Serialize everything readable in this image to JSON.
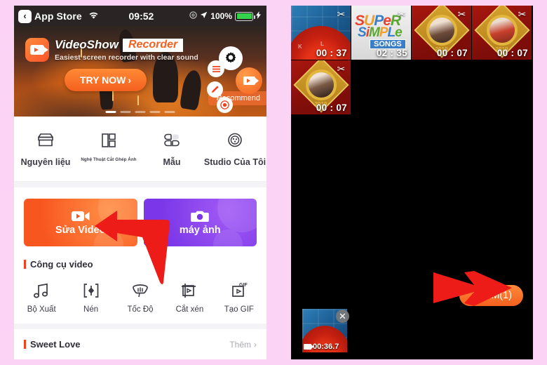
{
  "theme": {
    "page_bg": "#fbd4f5",
    "accent_orange": "#f4601f",
    "accent_purple": "#7a36e8",
    "arrow_red": "#ee1c18"
  },
  "left_phone": {
    "status_bar": {
      "back_label": "App Store",
      "back_icon": "chevron-left-icon",
      "wifi_icon": "wifi-icon",
      "time": "09:52",
      "location_icon": "location-arrow-icon",
      "battery_percent": "100%",
      "charging_icon": "bolt-icon"
    },
    "banner": {
      "app_icon": "videoshow-app-icon",
      "title_main": "VideoShow",
      "title_highlight": "Recorder",
      "subtitle": "Easiest screen recorder with clear sound",
      "cta_label": "TRY NOW",
      "cta_chevron": "›",
      "badge": "Recommend",
      "dots_total": 5,
      "dots_active": 1,
      "float_icons": [
        "gear-icon",
        "list-icon",
        "pen-icon",
        "record-icon",
        "video-camera-icon"
      ]
    },
    "nav_items": [
      {
        "label": "Nguyên liệu",
        "icon": "store-icon",
        "tiny": false
      },
      {
        "label": "Nghệ Thuật Cắt Ghép Ảnh",
        "icon": "collage-icon",
        "tiny": true
      },
      {
        "label": "Mẫu",
        "icon": "template-grid-icon",
        "tiny": false
      },
      {
        "label": "Studio Của Tôi",
        "icon": "studio-circle-icon",
        "tiny": false
      }
    ],
    "action_cards": [
      {
        "label": "Sửa Video",
        "icon": "video-camera-icon",
        "color": "orange"
      },
      {
        "label": "máy ảnh",
        "icon": "photo-camera-icon",
        "color": "purple"
      }
    ],
    "tools_section": {
      "title": "Công cụ video",
      "tools": [
        {
          "label": "Bộ Xuất",
          "icon": "music-note-icon"
        },
        {
          "label": "Nén",
          "icon": "compress-icon"
        },
        {
          "label": "Tốc Độ",
          "icon": "speed-icon"
        },
        {
          "label": "Cắt xén",
          "icon": "crop-icon"
        },
        {
          "label": "Tạo GIF",
          "icon": "gif-icon"
        }
      ]
    },
    "bottom_section": {
      "title": "Sweet Love",
      "more_label": "Thêm",
      "more_chevron": "›"
    },
    "annotation": {
      "arrow": "red-arrow-pointing-left",
      "points_to": "Sửa Video"
    }
  },
  "right_phone": {
    "thumbnails": [
      {
        "duration": "00 : 37",
        "art": "keyboard",
        "trim_icon": "scissors-icon"
      },
      {
        "duration": "02 : 35",
        "art": "super-simple-songs",
        "trim_icon": "scissors-icon",
        "logo_line1": "SUPeR",
        "logo_line2": "SiMPLe",
        "logo_badge": "SONGS"
      },
      {
        "duration": "00 : 07",
        "art": "red-frame-boy",
        "trim_icon": "scissors-icon",
        "year": "2019"
      },
      {
        "duration": "00 : 07",
        "art": "red-frame-redhair",
        "trim_icon": "scissors-icon",
        "year": "2019"
      },
      {
        "duration": "00 : 07",
        "art": "red-frame-girl",
        "trim_icon": "scissors-icon",
        "year": "2019"
      }
    ],
    "add_button": {
      "label": "THÊM(1)"
    },
    "selected_clip": {
      "duration": "00:36.7",
      "clip_icon": "video-clip-icon",
      "remove_icon": "close-icon"
    },
    "annotation": {
      "arrow": "red-arrow-pointing-right",
      "points_to": "THÊM(1)"
    }
  }
}
